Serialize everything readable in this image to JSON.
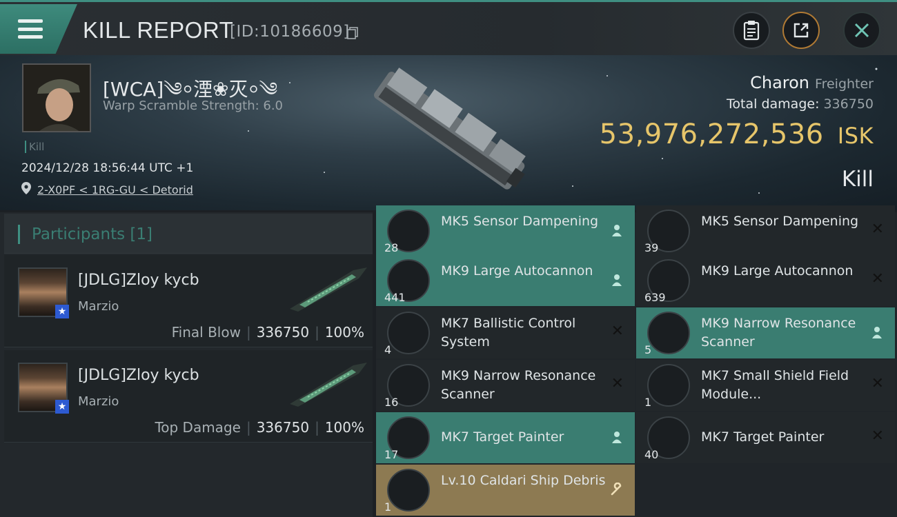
{
  "header": {
    "title": "KILL REPORT",
    "report_id": "[ID:10186609]"
  },
  "victim": {
    "name": "[WCA]༄⸰湮❀灭⸰༄",
    "warp_scramble": "Warp Scramble Strength: 6.0",
    "kill_tag": "Kill",
    "datetime": "2024/12/28 18:56:44 UTC +1",
    "location": "2-X0PF < 1RG-GU < Detorid"
  },
  "ship": {
    "name": "Charon",
    "class": "Freighter",
    "total_damage_label": "Total damage:",
    "total_damage": "336750",
    "isk_value": "53,976,272,536",
    "isk_unit": "ISK",
    "result": "Kill"
  },
  "participants": {
    "title": "Participants",
    "count": "[1]",
    "list": [
      {
        "name": "[JDLG]Zloy kycb",
        "ship": "Marzio",
        "role": "Final Blow",
        "damage": "336750",
        "percent": "100%"
      },
      {
        "name": "[JDLG]Zloy kycb",
        "ship": "Marzio",
        "role": "Top Damage",
        "damage": "336750",
        "percent": "100%"
      }
    ]
  },
  "items": [
    {
      "name": "MK5 Sensor Dampening",
      "qty": "28",
      "state": "dropped"
    },
    {
      "name": "MK5 Sensor Dampening",
      "qty": "39",
      "state": "destroyed"
    },
    {
      "name": "MK9 Large Autocannon",
      "qty": "441",
      "state": "dropped"
    },
    {
      "name": "MK9 Large Autocannon",
      "qty": "639",
      "state": "destroyed"
    },
    {
      "name": "MK7 Ballistic Control System",
      "qty": "4",
      "state": "destroyed"
    },
    {
      "name": "MK9 Narrow Resonance Scanner",
      "qty": "5",
      "state": "dropped"
    },
    {
      "name": "MK9 Narrow Resonance Scanner",
      "qty": "16",
      "state": "destroyed"
    },
    {
      "name": "MK7 Small Shield Field Module...",
      "qty": "1",
      "state": "destroyed"
    },
    {
      "name": "MK7 Target Painter",
      "qty": "17",
      "state": "dropped"
    },
    {
      "name": "MK7 Target Painter",
      "qty": "40",
      "state": "destroyed"
    },
    {
      "name": "Lv.10 Caldari Ship Debris",
      "qty": "1",
      "state": "salvage"
    }
  ],
  "colors": {
    "accent": "#3f8f82",
    "dropped": "#3a7d71",
    "destroyed": "#22272a",
    "salvage": "#8d7a52",
    "isk": "#e6c56a"
  }
}
